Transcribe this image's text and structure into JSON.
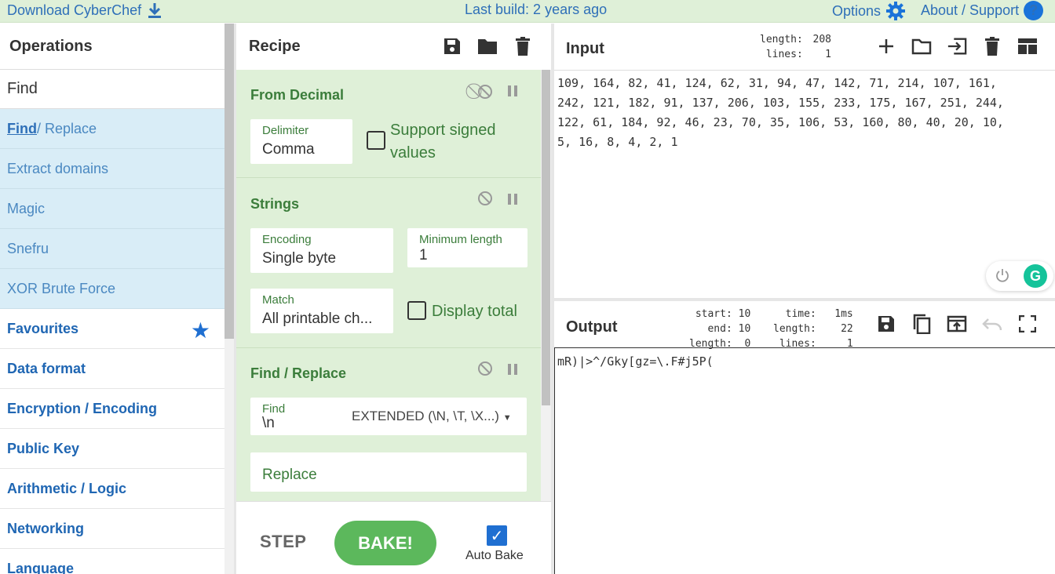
{
  "banner": {
    "download": "Download CyberChef",
    "last_build": "Last build: 2 years ago",
    "options": "Options",
    "about": "About / Support"
  },
  "operations": {
    "title": "Operations",
    "search_value": "Find",
    "results": [
      {
        "match": "Find",
        "rest": " / Replace"
      },
      {
        "match": "",
        "rest": "Extract domains"
      },
      {
        "match": "",
        "rest": "Magic"
      },
      {
        "match": "",
        "rest": "Snefru"
      },
      {
        "match": "",
        "rest": "XOR Brute Force"
      }
    ],
    "categories": [
      "Favourites",
      "Data format",
      "Encryption / Encoding",
      "Public Key",
      "Arithmetic / Logic",
      "Networking",
      "Language"
    ]
  },
  "recipe": {
    "title": "Recipe",
    "ops": [
      {
        "name": "From Decimal",
        "delimiter_label": "Delimiter",
        "delimiter_value": "Comma",
        "signed_label": "Support signed values"
      },
      {
        "name": "Strings",
        "encoding_label": "Encoding",
        "encoding_value": "Single byte",
        "minlen_label": "Minimum length",
        "minlen_value": "1",
        "match_label": "Match",
        "match_value": "All printable ch...",
        "display_total_label": "Display total"
      },
      {
        "name": "Find / Replace",
        "find_label": "Find",
        "find_value": "\\n",
        "find_mode": "EXTENDED (\\N, \\T, \\X...)",
        "replace_placeholder": "Replace"
      }
    ],
    "step_label": "STEP",
    "bake_label": "BAKE!",
    "auto_bake_label": "Auto Bake",
    "auto_bake_checked": true
  },
  "input": {
    "title": "Input",
    "stats_labels": "length:\nlines:",
    "stats_values": "208\n1",
    "text": "109, 164, 82, 41, 124, 62, 31, 94, 47, 142, 71, 214, 107, 161,\n242, 121, 182, 91, 137, 206, 103, 155, 233, 175, 167, 251, 244,\n122, 61, 184, 92, 46, 23, 70, 35, 106, 53, 160, 80, 40, 20, 10,\n5, 16, 8, 4, 2, 1"
  },
  "output": {
    "title": "Output",
    "stats_col1": "start: 10\n  end: 10\nlength:  0",
    "stats_col2": "  time:   1ms\nlength:    22\n lines:     1",
    "text": "mR)|>^/Gky[gz=\\.F#j5P("
  },
  "colors": {
    "banner_bg": "#dff0d8",
    "recipe_bg": "#dff0d8",
    "op_name": "#3b7d3b",
    "link_blue": "#2e6fb8",
    "search_result_bg": "#d9edf7",
    "bake_green": "#5cb85c",
    "grammarly_green": "#15c39a"
  }
}
